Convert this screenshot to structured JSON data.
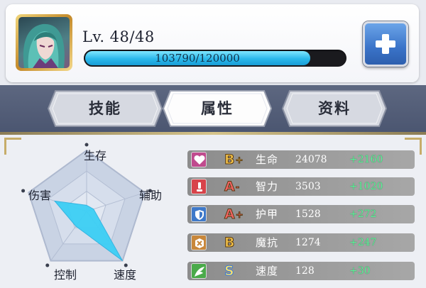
{
  "header": {
    "level_text": "Lv. 48/48",
    "xp_text": "103790/120000",
    "xp_current": 103790,
    "xp_max": 120000,
    "xp_fraction": 0.865,
    "add_button_icon": "plus-icon"
  },
  "tabs": [
    {
      "label": "技能",
      "selected": false
    },
    {
      "label": "属性",
      "selected": true
    },
    {
      "label": "资料",
      "selected": false
    }
  ],
  "radar": {
    "axes": [
      "生存",
      "辅助",
      "速度",
      "控制",
      "伤害"
    ],
    "fill_color": "#3ccff5"
  },
  "stats": [
    {
      "icon": "heart-icon",
      "icon_color": "#c04b8e",
      "grade": "B",
      "modifier": "+",
      "grade_color": "#f2c24a",
      "name": "生命",
      "value": "24078",
      "bonus": "+2160"
    },
    {
      "icon": "potion-icon",
      "icon_color": "#d8434a",
      "grade": "A",
      "modifier": "-",
      "grade_color": "#f26464",
      "name": "智力",
      "value": "3503",
      "bonus": "+1020"
    },
    {
      "icon": "shield-icon",
      "icon_color": "#3f79c9",
      "grade": "A",
      "modifier": "+",
      "grade_color": "#f26464",
      "name": "护甲",
      "value": "1528",
      "bonus": "+272"
    },
    {
      "icon": "magic-resist-icon",
      "icon_color": "#c8873b",
      "grade": "B",
      "modifier": "",
      "grade_color": "#f2c24a",
      "name": "魔抗",
      "value": "1274",
      "bonus": "+247"
    },
    {
      "icon": "wing-icon",
      "icon_color": "#4aaa4a",
      "grade": "S",
      "modifier": "",
      "grade_color": "#ffe36a",
      "name": "速度",
      "value": "128",
      "bonus": "+30"
    }
  ]
}
